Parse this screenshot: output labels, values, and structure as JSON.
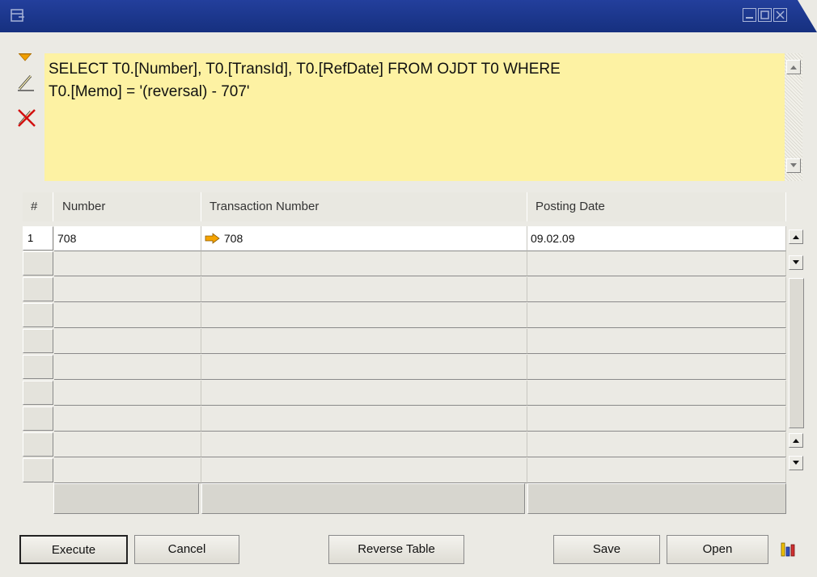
{
  "query": {
    "text": "SELECT T0.[Number], T0.[TransId], T0.[RefDate] FROM OJDT T0 WHERE\nT0.[Memo] = '(reversal) - 707'"
  },
  "grid": {
    "columns": [
      "#",
      "Number",
      "Transaction Number",
      "Posting Date"
    ],
    "rows": [
      {
        "index": "1",
        "number": "708",
        "transaction_number": "708",
        "posting_date": "09.02.09"
      }
    ]
  },
  "buttons": {
    "execute": "Execute",
    "cancel": "Cancel",
    "reverse_table": "Reverse Table",
    "save": "Save",
    "open": "Open"
  },
  "icons": {
    "window": "window-icon",
    "filter": "filter-triangle-icon",
    "edit": "pencil-icon",
    "delete": "pencil-delete-icon",
    "link_arrow": "orange-arrow-icon",
    "chart": "bar-chart-icon"
  },
  "colors": {
    "titlebar": "#1b3688",
    "query_background": "#fdf2a3",
    "link_arrow": "#f5a300"
  }
}
